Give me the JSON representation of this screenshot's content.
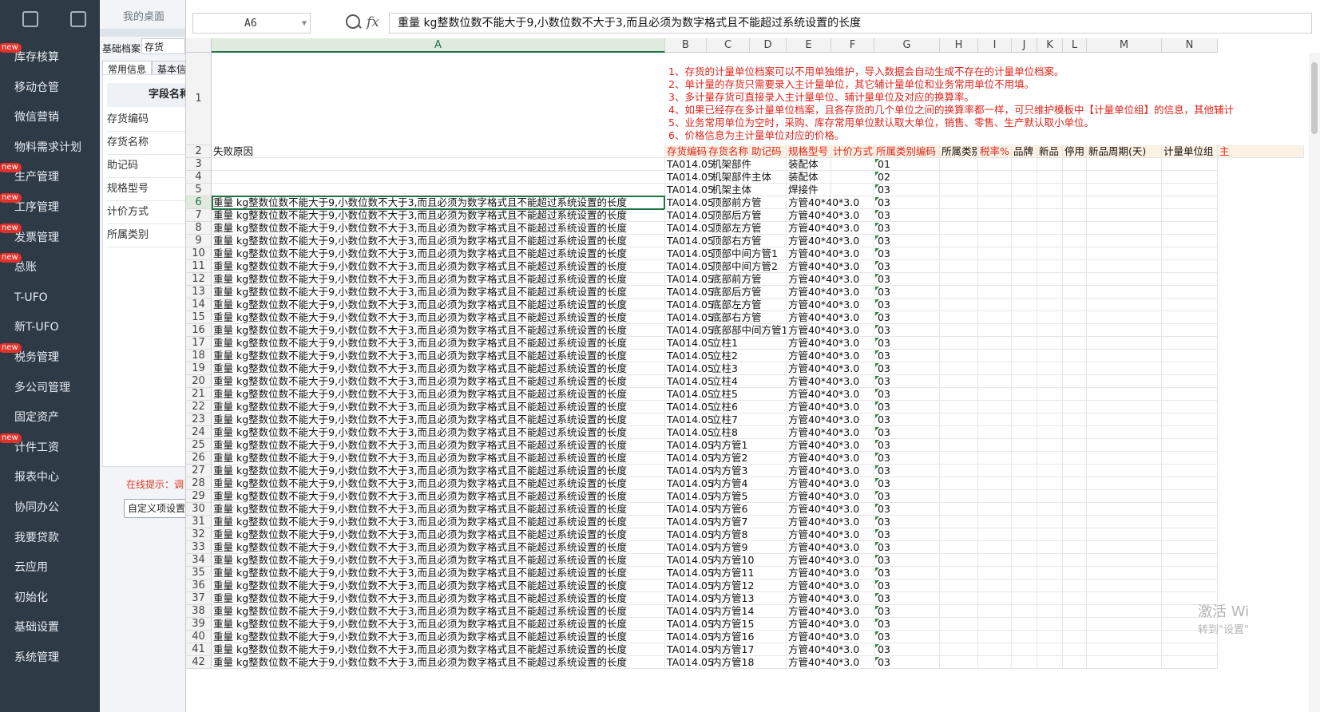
{
  "sidebar": {
    "items": [
      {
        "label": "库存核算",
        "badge": "new"
      },
      {
        "label": "移动仓管",
        "badge": ""
      },
      {
        "label": "微信营销",
        "badge": ""
      },
      {
        "label": "物料需求计划",
        "badge": ""
      },
      {
        "label": "生产管理",
        "badge": "new"
      },
      {
        "label": "工序管理",
        "badge": "new"
      },
      {
        "label": "发票管理",
        "badge": "new"
      },
      {
        "label": "总账",
        "badge": "new"
      },
      {
        "label": "T-UFO",
        "badge": ""
      },
      {
        "label": "新T-UFO",
        "badge": ""
      },
      {
        "label": "税务管理",
        "badge": "new"
      },
      {
        "label": "多公司管理",
        "badge": ""
      },
      {
        "label": "固定资产",
        "badge": ""
      },
      {
        "label": "计件工资",
        "badge": "new"
      },
      {
        "label": "报表中心",
        "badge": ""
      },
      {
        "label": "协同办公",
        "badge": ""
      },
      {
        "label": "我要贷款",
        "badge": ""
      },
      {
        "label": "云应用",
        "badge": ""
      },
      {
        "label": "初始化",
        "badge": ""
      },
      {
        "label": "基础设置",
        "badge": ""
      },
      {
        "label": "系统管理",
        "badge": ""
      }
    ]
  },
  "midpanel": {
    "desk_tab": "我的桌面",
    "archive_label": "基础档案",
    "archive_value": "存货",
    "tabs": [
      "常用信息",
      "基本信"
    ],
    "field_header": "字段名称",
    "fields": [
      "存货编码",
      "存货名称",
      "助记码",
      "规格型号",
      "计价方式",
      "所属类别"
    ],
    "tip": "在线提示：调",
    "custom_button": "自定义项设置"
  },
  "sheet": {
    "name_box": "A6",
    "formula": "重量 kg整数位数不能大于9,小数位数不大于3,而且必须为数字格式且不能超过系统设置的长度",
    "columns": [
      "A",
      "B",
      "C",
      "D",
      "E",
      "F",
      "G",
      "H",
      "I",
      "J",
      "K",
      "L",
      "M",
      "N"
    ],
    "notes": [
      "1、存货的计量单位档案可以不用单独维护，导入数据会自动生成不存在的计量单位档案。",
      "2、单计量的存货只需要录入主计量单位，其它辅计量单位和业务常用单位不用填。",
      "3、多计量存货可直接录入主计量单位、辅计量单位及对应的换算率。",
      "4、如果已经存在多计量单位档案，且各存货的几个单位之间的换算率都一样，可只维护模板中【计量单位组】的信息，其他辅计",
      "5、业务常用单位为空时，采购、库存常用单位默认取大单位，销售、零售、生产默认取小单位。",
      "6、价格信息为主计量单位对应的价格。"
    ],
    "header_row": {
      "a": "失败原因",
      "cols": [
        "存货编码",
        "存货名称",
        "助记码",
        "规格型号",
        "计价方式",
        "所属类别编码",
        "所属类别",
        "税率%",
        "品牌",
        "新品",
        "停用",
        "新品周期(天)",
        "计量单位组",
        "主"
      ]
    },
    "error_text": "重量 kg整数位数不能大于9,小数位数不大于3,而且必须为数字格式且不能超过系统设置的长度",
    "rows": [
      {
        "n": "3",
        "a": "",
        "code": "TA014.05",
        "name": "机架部件",
        "spec": "装配体",
        "cat": "01"
      },
      {
        "n": "4",
        "a": "",
        "code": "TA014.05",
        "name": "机架部件主体",
        "spec": "装配体",
        "cat": "02"
      },
      {
        "n": "5",
        "a": "",
        "code": "TA014.05",
        "name": "机架主体",
        "spec": "焊接件",
        "cat": "03"
      },
      {
        "n": "6",
        "a": "err",
        "code": "TA014.05",
        "name": "顶部前方管",
        "spec": "方管40*40*3.0",
        "cat": "03"
      },
      {
        "n": "7",
        "a": "err",
        "code": "TA014.05",
        "name": "顶部后方管",
        "spec": "方管40*40*3.0",
        "cat": "03"
      },
      {
        "n": "8",
        "a": "err",
        "code": "TA014.05",
        "name": "顶部左方管",
        "spec": "方管40*40*3.0",
        "cat": "03"
      },
      {
        "n": "9",
        "a": "err",
        "code": "TA014.05",
        "name": "顶部右方管",
        "spec": "方管40*40*3.0",
        "cat": "03"
      },
      {
        "n": "10",
        "a": "err",
        "code": "TA014.05",
        "name": "顶部中间方管1",
        "spec": "方管40*40*3.0",
        "cat": "03"
      },
      {
        "n": "11",
        "a": "err",
        "code": "TA014.05",
        "name": "顶部中间方管2",
        "spec": "方管40*40*3.0",
        "cat": "03"
      },
      {
        "n": "12",
        "a": "err",
        "code": "TA014.05",
        "name": "底部前方管",
        "spec": "方管40*40*3.0",
        "cat": "03"
      },
      {
        "n": "13",
        "a": "err",
        "code": "TA014.05",
        "name": "底部后方管",
        "spec": "方管40*40*3.0",
        "cat": "03"
      },
      {
        "n": "14",
        "a": "err",
        "code": "TA014.05",
        "name": "底部左方管",
        "spec": "方管40*40*3.0",
        "cat": "03"
      },
      {
        "n": "15",
        "a": "err",
        "code": "TA014.05",
        "name": "底部右方管",
        "spec": "方管40*40*3.0",
        "cat": "03"
      },
      {
        "n": "16",
        "a": "err",
        "code": "TA014.05",
        "name": "底部部中间方管1",
        "spec": "方管40*40*3.0",
        "cat": "03"
      },
      {
        "n": "17",
        "a": "err",
        "code": "TA014.05",
        "name": "立柱1",
        "spec": "方管40*40*3.0",
        "cat": "03"
      },
      {
        "n": "18",
        "a": "err",
        "code": "TA014.05",
        "name": "立柱2",
        "spec": "方管40*40*3.0",
        "cat": "03"
      },
      {
        "n": "19",
        "a": "err",
        "code": "TA014.05",
        "name": "立柱3",
        "spec": "方管40*40*3.0",
        "cat": "03"
      },
      {
        "n": "20",
        "a": "err",
        "code": "TA014.05",
        "name": "立柱4",
        "spec": "方管40*40*3.0",
        "cat": "03"
      },
      {
        "n": "21",
        "a": "err",
        "code": "TA014.05",
        "name": "立柱5",
        "spec": "方管40*40*3.0",
        "cat": "03"
      },
      {
        "n": "22",
        "a": "err",
        "code": "TA014.05",
        "name": "立柱6",
        "spec": "方管40*40*3.0",
        "cat": "03"
      },
      {
        "n": "23",
        "a": "err",
        "code": "TA014.05",
        "name": "立柱7",
        "spec": "方管40*40*3.0",
        "cat": "03"
      },
      {
        "n": "24",
        "a": "err",
        "code": "TA014.05",
        "name": "立柱8",
        "spec": "方管40*40*3.0",
        "cat": "03"
      },
      {
        "n": "25",
        "a": "err",
        "code": "TA014.05",
        "name": "内方管1",
        "spec": "方管40*40*3.0",
        "cat": "03"
      },
      {
        "n": "26",
        "a": "err",
        "code": "TA014.05",
        "name": "内方管2",
        "spec": "方管40*40*3.0",
        "cat": "03"
      },
      {
        "n": "27",
        "a": "err",
        "code": "TA014.05",
        "name": "内方管3",
        "spec": "方管40*40*3.0",
        "cat": "03"
      },
      {
        "n": "28",
        "a": "err",
        "code": "TA014.05",
        "name": "内方管4",
        "spec": "方管40*40*3.0",
        "cat": "03"
      },
      {
        "n": "29",
        "a": "err",
        "code": "TA014.05",
        "name": "内方管5",
        "spec": "方管40*40*3.0",
        "cat": "03"
      },
      {
        "n": "30",
        "a": "err",
        "code": "TA014.05",
        "name": "内方管6",
        "spec": "方管40*40*3.0",
        "cat": "03"
      },
      {
        "n": "31",
        "a": "err",
        "code": "TA014.05",
        "name": "内方管7",
        "spec": "方管40*40*3.0",
        "cat": "03"
      },
      {
        "n": "32",
        "a": "err",
        "code": "TA014.05",
        "name": "内方管8",
        "spec": "方管40*40*3.0",
        "cat": "03"
      },
      {
        "n": "33",
        "a": "err",
        "code": "TA014.05",
        "name": "内方管9",
        "spec": "方管40*40*3.0",
        "cat": "03"
      },
      {
        "n": "34",
        "a": "err",
        "code": "TA014.05",
        "name": "内方管10",
        "spec": "方管40*40*3.0",
        "cat": "03"
      },
      {
        "n": "35",
        "a": "err",
        "code": "TA014.05",
        "name": "内方管11",
        "spec": "方管40*40*3.0",
        "cat": "03"
      },
      {
        "n": "36",
        "a": "err",
        "code": "TA014.05",
        "name": "内方管12",
        "spec": "方管40*40*3.0",
        "cat": "03"
      },
      {
        "n": "37",
        "a": "err",
        "code": "TA014.05",
        "name": "内方管13",
        "spec": "方管40*40*3.0",
        "cat": "03"
      },
      {
        "n": "38",
        "a": "err",
        "code": "TA014.05",
        "name": "内方管14",
        "spec": "方管40*40*3.0",
        "cat": "03"
      },
      {
        "n": "39",
        "a": "err",
        "code": "TA014.05",
        "name": "内方管15",
        "spec": "方管40*40*3.0",
        "cat": "03"
      },
      {
        "n": "40",
        "a": "err",
        "code": "TA014.05",
        "name": "内方管16",
        "spec": "方管40*40*3.0",
        "cat": "03"
      },
      {
        "n": "41",
        "a": "err",
        "code": "TA014.05",
        "name": "内方管17",
        "spec": "方管40*40*3.0",
        "cat": "03"
      },
      {
        "n": "42",
        "a": "err",
        "code": "TA014.05",
        "name": "内方管18",
        "spec": "方管40*40*3.0",
        "cat": "03"
      }
    ]
  },
  "watermark": {
    "line1": "激活 Wi",
    "line2": "转到\"设置\""
  }
}
